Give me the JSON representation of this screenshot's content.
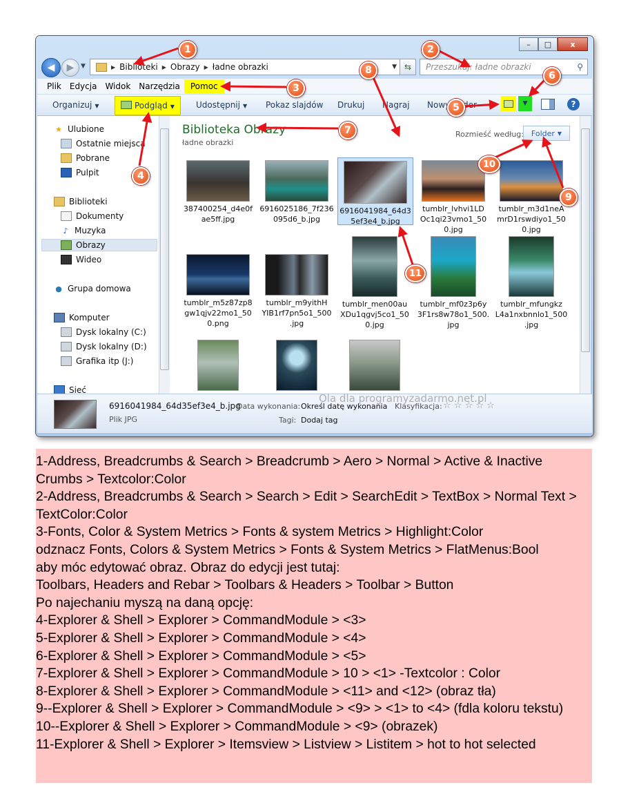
{
  "window": {
    "caption_buttons": [
      "–",
      "□",
      "x"
    ],
    "address": {
      "crumbs": [
        "Biblioteki",
        "Obrazy",
        "ładne obrazki"
      ]
    },
    "search": {
      "placeholder": "Przeszukaj: ładne obrazki"
    },
    "menu": [
      "Plik",
      "Edycja",
      "Widok",
      "Narzędzia",
      "Pomoc"
    ],
    "toolbar": {
      "organize": "Organizuj",
      "preview": "Podgląd",
      "share": "Udostępnij",
      "slideshow": "Pokaz slajdów",
      "print": "Drukuj",
      "burn": "Nagraj",
      "new_folder": "Nowy folder"
    },
    "nav": {
      "favorites": "Ulubione",
      "recent": "Ostatnie miejsca",
      "downloads": "Pobrane",
      "desktop": "Pulpit",
      "libraries": "Biblioteki",
      "documents": "Dokumenty",
      "music": "Muzyka",
      "pictures": "Obrazy",
      "video": "Wideo",
      "homegroup": "Grupa domowa",
      "computer": "Komputer",
      "disk_c": "Dysk lokalny (C:)",
      "disk_d": "Dysk lokalny (D:)",
      "disk_j": "Grafika itp (J:)",
      "network": "Sieć"
    },
    "library": {
      "title": "Biblioteka Obrazy",
      "subtitle": "ładne obrazki",
      "arrange_label": "Rozmieść według:",
      "arrange_value": "Folder"
    },
    "files": [
      {
        "name1": "387400254_d4e0f",
        "name2": "ae5ff.jpg",
        "name3": ""
      },
      {
        "name1": "6916025186_7f236",
        "name2": "095d6_b.jpg",
        "name3": ""
      },
      {
        "name1": "6916041984_64d3",
        "name2": "5ef3e4_b.jpg",
        "name3": ""
      },
      {
        "name1": "tumblr_lvhvi1LD",
        "name2": "Oc1qi23vmo1_50",
        "name3": "0.jpg"
      },
      {
        "name1": "tumblr_m3d1neA",
        "name2": "mrD1rswdiyo1_50",
        "name3": "0.jpg"
      },
      {
        "name1": "tumblr_m5z87zp8",
        "name2": "gw1qjv22mo1_50",
        "name3": "0.png"
      },
      {
        "name1": "tumblr_m9yithH",
        "name2": "YIB1rf7pn5o1_500",
        "name3": ".jpg"
      },
      {
        "name1": "tumblr_men00au",
        "name2": "XDu1qgvj5co1_50",
        "name3": "0.jpg"
      },
      {
        "name1": "tumblr_mf0z3p6y",
        "name2": "3F1rs8w78o1_500.",
        "name3": "jpg"
      },
      {
        "name1": "tumblr_mfungkz",
        "name2": "L4a1nxbnnlo1_500",
        "name3": ".jpg"
      },
      {
        "name1": "",
        "name2": "",
        "name3": ""
      },
      {
        "name1": "",
        "name2": "",
        "name3": ""
      },
      {
        "name1": "",
        "name2": "",
        "name3": ""
      }
    ],
    "details": {
      "filename": "6916041984_64d35ef3e4_b.jpg",
      "filetype": "Plik JPG",
      "date_label": "Data wykonania:",
      "date_value": "Określ datę wykonania",
      "rating_label": "Klasyfikacja:",
      "rating_stars": "☆ ☆ ☆ ☆ ☆",
      "tags_label": "Tagi:",
      "tags_value": "Dodaj tag"
    },
    "watermark": "Ola dla programyzadarmo.net.pl"
  },
  "markers": [
    "1",
    "2",
    "3",
    "4",
    "5",
    "6",
    "7",
    "8",
    "9",
    "10",
    "11"
  ],
  "notes": [
    "1-Address, Breadcrumbs & Search > Breadcrumb > Aero > Normal > Active & Inactive Crumbs > Textcolor:Color",
    "2-Address, Breadcrumbs & Search > Search > Edit > SearchEdit > TextBox > Normal Text > TextColor:Color",
    "3-Fonts, Color & System Metrics > Fonts & system Metrics > Highlight:Color",
    "odznacz Fonts, Colors & System Metrics > Fonts & System Metrics > FlatMenus:Bool",
    "aby móc edytować obraz. Obraz do edycji jest tutaj:",
    "Toolbars, Headers and Rebar > Toolbars & Headers > Toolbar > Button",
    "Po najechaniu myszą na daną opcję:",
    "4-Explorer & Shell > Explorer > CommandModule > <3>",
    "5-Explorer & Shell > Explorer > CommandModule > <4>",
    "6-Explorer & Shell > Explorer > CommandModule > <5>",
    "7-Explorer & Shell > Explorer > CommandModule > 10 > <1> -Textcolor : Color",
    "8-Explorer & Shell > Explorer > CommandModule > <11> and <12> (obraz tła)",
    "9--Explorer & Shell > Explorer > CommandModule > <9> > <1> to <4> (fdla koloru tekstu)",
    "10--Explorer & Shell > Explorer > CommandModule > <9> (obrazek)",
    "11-Explorer & Shell > Explorer > Itemsview > Listview > Listitem > hot to hot selected"
  ],
  "colors": {
    "highlight": "#ffff00",
    "green_button": "#22dd22",
    "notes_bg": "#ffc6c6",
    "marker": "#e14a14",
    "library_title": "#1e6b2a"
  }
}
